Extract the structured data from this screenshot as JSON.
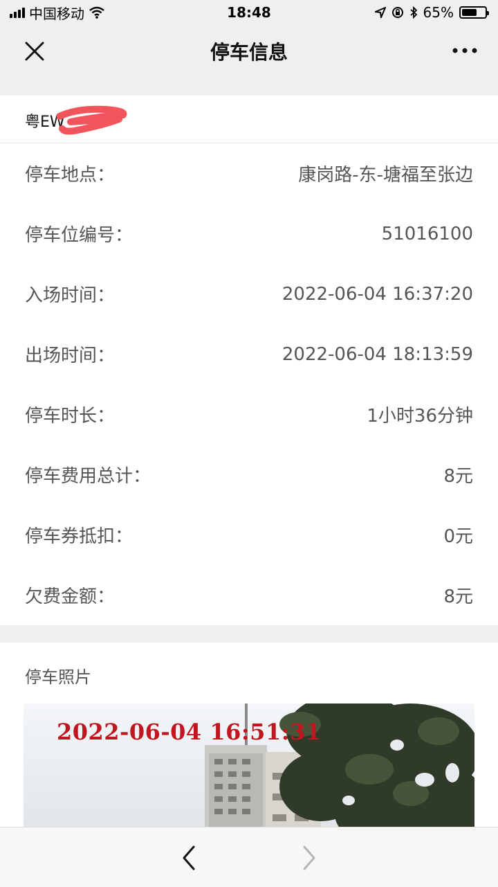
{
  "status_bar": {
    "carrier": "中国移动",
    "time": "18:48",
    "battery": "65%",
    "battery_level": 0.65
  },
  "nav": {
    "title": "停车信息"
  },
  "plate": {
    "text": "粤EW"
  },
  "details": [
    {
      "label": "停车地点：",
      "value": "康岗路-东-塘福至张边"
    },
    {
      "label": "停车位编号：",
      "value": "51016100"
    },
    {
      "label": "入场时间：",
      "value": "2022-06-04 16:37:20"
    },
    {
      "label": "出场时间：",
      "value": "2022-06-04 18:13:59"
    },
    {
      "label": "停车时长：",
      "value": "1小时36分钟"
    },
    {
      "label": "停车费用总计：",
      "value": "8元"
    },
    {
      "label": "停车券抵扣：",
      "value": "0元"
    },
    {
      "label": "欠费金额：",
      "value": "8元"
    }
  ],
  "photo": {
    "title": "停车照片",
    "timestamp": "2022-06-04 16:51:31"
  },
  "colors": {
    "page_bg": "#efefef",
    "card_bg": "#ffffff",
    "text_secondary": "#555555",
    "redaction": "#f2545b",
    "timestamp_red": "#c0161f"
  },
  "icons": {
    "close": "close-icon",
    "more": "more-dots-icon",
    "back": "chevron-left-icon",
    "forward": "chevron-right-icon",
    "wifi": "wifi-icon",
    "location": "location-arrow-icon",
    "rotation_lock": "rotation-lock-icon",
    "bluetooth": "bluetooth-icon"
  }
}
